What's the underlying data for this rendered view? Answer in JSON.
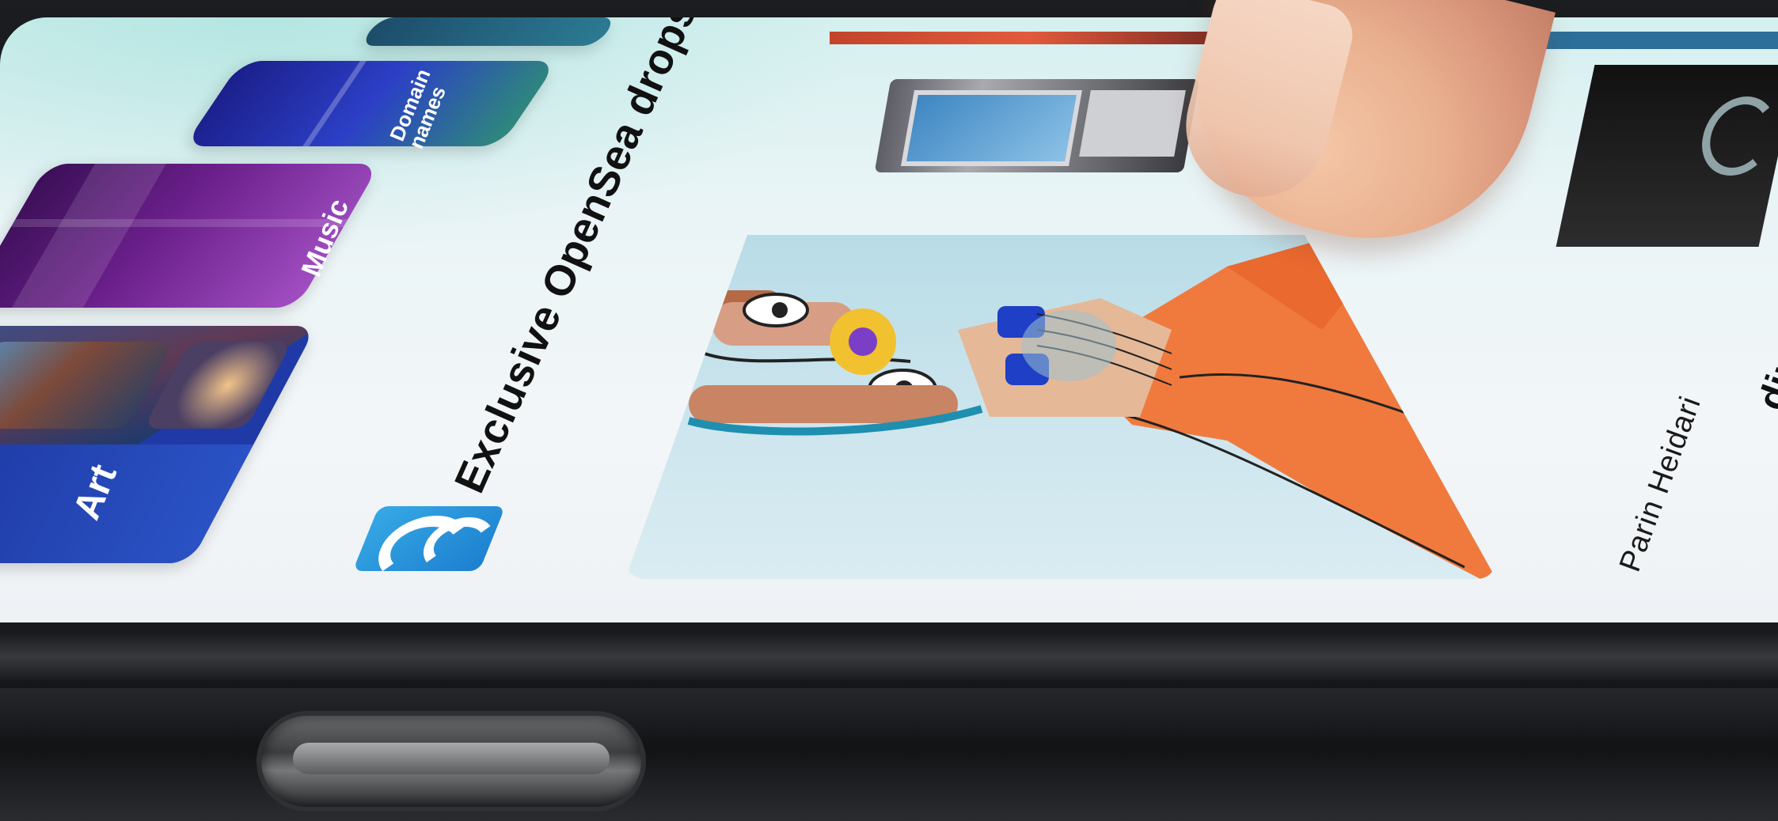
{
  "categories": [
    {
      "label": "Art"
    },
    {
      "label": "Music"
    },
    {
      "label": "Domain names"
    }
  ],
  "section": {
    "title": "Exclusive OpenSea drops",
    "logo_icon": "opensea-wave-icon"
  },
  "drop": {
    "artist": "Parin Heidari"
  },
  "next_section": {
    "title_partial": "ding collections"
  },
  "colors": {
    "opensea_blue": "#2081E2",
    "screen_bg": "#EEF3F6"
  }
}
